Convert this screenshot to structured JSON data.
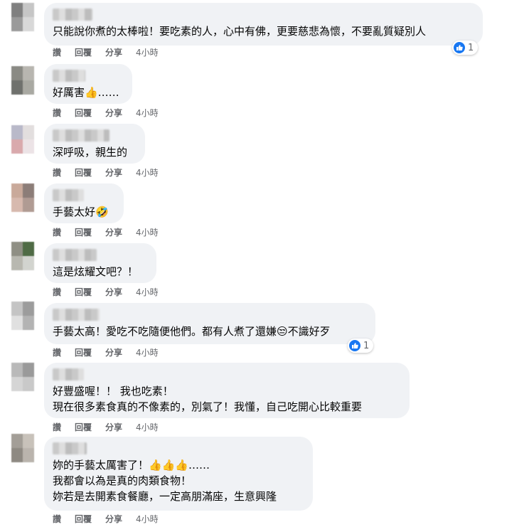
{
  "actions": {
    "like": "讚",
    "reply": "回覆",
    "share": "分享"
  },
  "comments": [
    {
      "lines": [
        "只能說你煮的太棒啦！要吃素的人，心中有佛，更要慈悲為懷，不要亂質疑別人"
      ],
      "time": "4小時",
      "reactions": "1"
    },
    {
      "lines": [
        "好厲害👍……"
      ],
      "time": "4小時"
    },
    {
      "lines": [
        "深呼吸，親生的"
      ],
      "time": "4小時"
    },
    {
      "lines": [
        "手藝太好🤣"
      ],
      "time": "4小時"
    },
    {
      "lines": [
        "這是炫耀文吧？！"
      ],
      "time": "4小時"
    },
    {
      "lines": [
        "手藝太高！愛吃不吃隨便他們。都有人煮了還嫌😒不識好歹"
      ],
      "time": "4小時",
      "reactions": "1"
    },
    {
      "lines": [
        "好豐盛喔！！ 我也吃素！",
        "現在很多素食真的不像素的，別氣了！我懂，自己吃開心比較重要"
      ],
      "time": "4小時"
    },
    {
      "lines": [
        "妳的手藝太厲害了！👍👍👍……",
        "我都會以為是真的肉類食物！",
        "妳若是去開素食餐廳，一定高朋滿座，生意興隆"
      ],
      "time": "4小時"
    }
  ],
  "colors": {
    "bubble": "#f0f2f5",
    "meta": "#65676b",
    "like": "#1877f2"
  },
  "icons": {
    "reaction": "like-icon"
  }
}
